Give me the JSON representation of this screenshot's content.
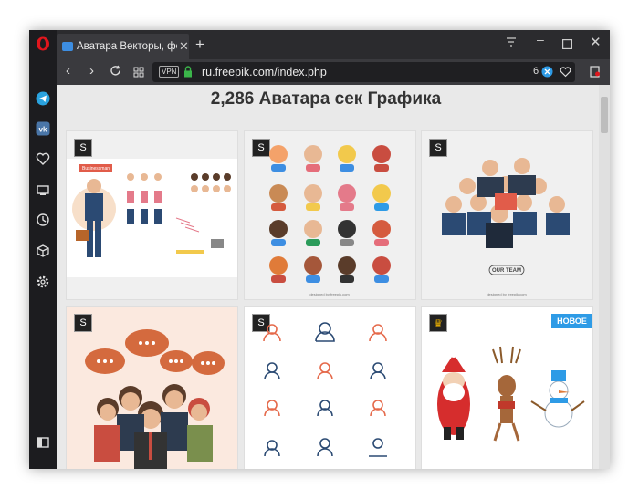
{
  "browser": {
    "tab_title": "Аватара Векторы, фото и",
    "url": "ru.freepik.com/index.php",
    "vpn_label": "VPN",
    "adblock_count": "6"
  },
  "page": {
    "heading": "2,286 Аватара сек Графика",
    "cards": [
      {
        "badge": "S",
        "caption": "Businessman"
      },
      {
        "badge": "S",
        "caption": "designed by freepik.com"
      },
      {
        "badge": "S",
        "caption": "OUR TEAM",
        "footer": "designed by freepik.com"
      },
      {
        "badge": "S"
      },
      {
        "badge": "S"
      },
      {
        "badge": "crown",
        "new_label": "НОВОЕ"
      }
    ]
  },
  "icons": {
    "sidebar": [
      "opera-logo-icon",
      "telegram-icon",
      "vk-icon",
      "heart-icon",
      "snapshot-icon",
      "history-icon",
      "extensions-icon",
      "settings-icon",
      "sidebar-toggle-icon"
    ],
    "accent": "#2e9be6"
  }
}
